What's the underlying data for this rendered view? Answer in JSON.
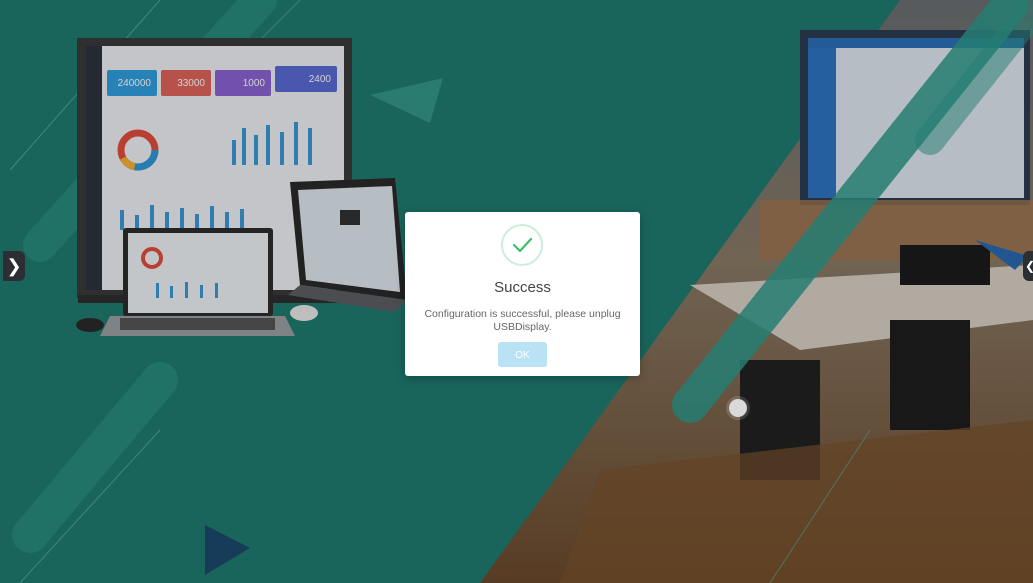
{
  "dialog": {
    "title": "Success",
    "message": "Configuration is successful, please unplug USBDisplay.",
    "ok_label": "OK"
  },
  "dashboard": {
    "kpis": [
      {
        "value": "240000",
        "color": "#2f9fe0"
      },
      {
        "value": "33000",
        "color": "#e0645c"
      },
      {
        "value": "1000",
        "color": "#8a63d2"
      },
      {
        "value": "2400",
        "color": "#5b6bd6"
      }
    ]
  },
  "icons": {
    "left_nav": "chevron-right-icon",
    "right_nav": "chevron-left-icon",
    "status": "check-icon"
  },
  "colors": {
    "background": "#1f7a6f",
    "accent": "#2e9a8c",
    "ok_button": "#b9e2f5",
    "check": "#3cbf6b"
  }
}
